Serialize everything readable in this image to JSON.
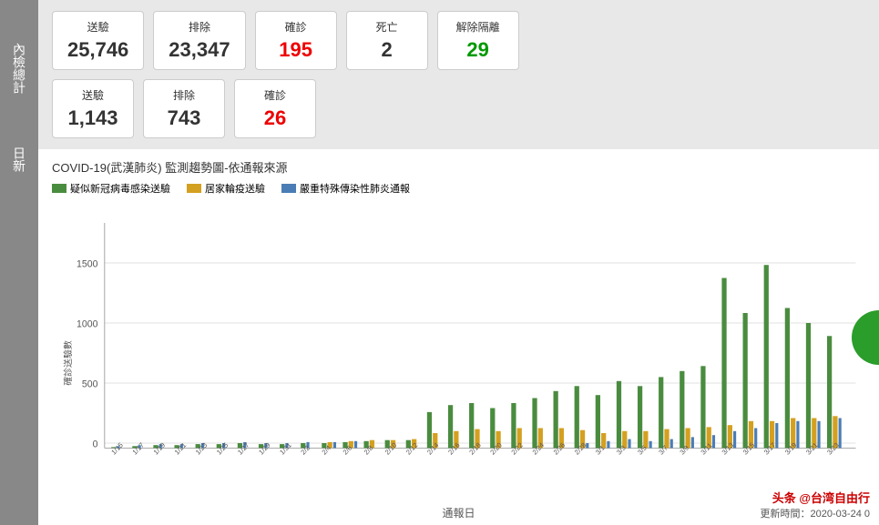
{
  "sidebar": {
    "total_label": "內檢總計",
    "daily_label": "日新"
  },
  "stats": {
    "total": {
      "sent": {
        "label": "送驗",
        "value": "25,746"
      },
      "excluded": {
        "label": "排除",
        "value": "23,347"
      },
      "confirmed": {
        "label": "確診",
        "value": "195"
      },
      "deaths": {
        "label": "死亡",
        "value": "2"
      },
      "released": {
        "label": "解除隔離",
        "value": "29"
      }
    },
    "daily": {
      "sent": {
        "label": "送驗",
        "value": "1,143"
      },
      "excluded": {
        "label": "排除",
        "value": "743"
      },
      "confirmed": {
        "label": "確診",
        "value": "26"
      }
    }
  },
  "chart": {
    "title": "COVID-19(武漢肺炎) 監測趨勢圖-依通報來源",
    "legend": [
      {
        "label": "疑似新冠病毒感染送驗",
        "color": "#4a8c3f"
      },
      {
        "label": "居家輪疫送驗",
        "color": "#d4a020"
      },
      {
        "label": "嚴重特殊傳染性肺炎通報",
        "color": "#4a7db5"
      }
    ],
    "x_title": "通報日",
    "y_max": 1500,
    "y_ticks": [
      0,
      500,
      1000,
      1500
    ],
    "x_labels": [
      "1/15",
      "1/17",
      "1/19",
      "1/21",
      "1/23",
      "1/25",
      "1/27",
      "1/29",
      "1/31",
      "2/2",
      "2/4",
      "2/6",
      "2/8",
      "2/10",
      "2/12",
      "2/14",
      "2/16",
      "2/18",
      "2/20",
      "2/22",
      "2/24",
      "2/26",
      "2/28",
      "3/1",
      "3/3",
      "3/5",
      "3/7",
      "3/9",
      "3/11",
      "3/13",
      "3/15",
      "3/17",
      "3/19",
      "3/21",
      "3/23"
    ]
  },
  "watermark": {
    "brand": "头条 @台湾自由行",
    "update_time": "更新時間：2020-03-24 0"
  }
}
